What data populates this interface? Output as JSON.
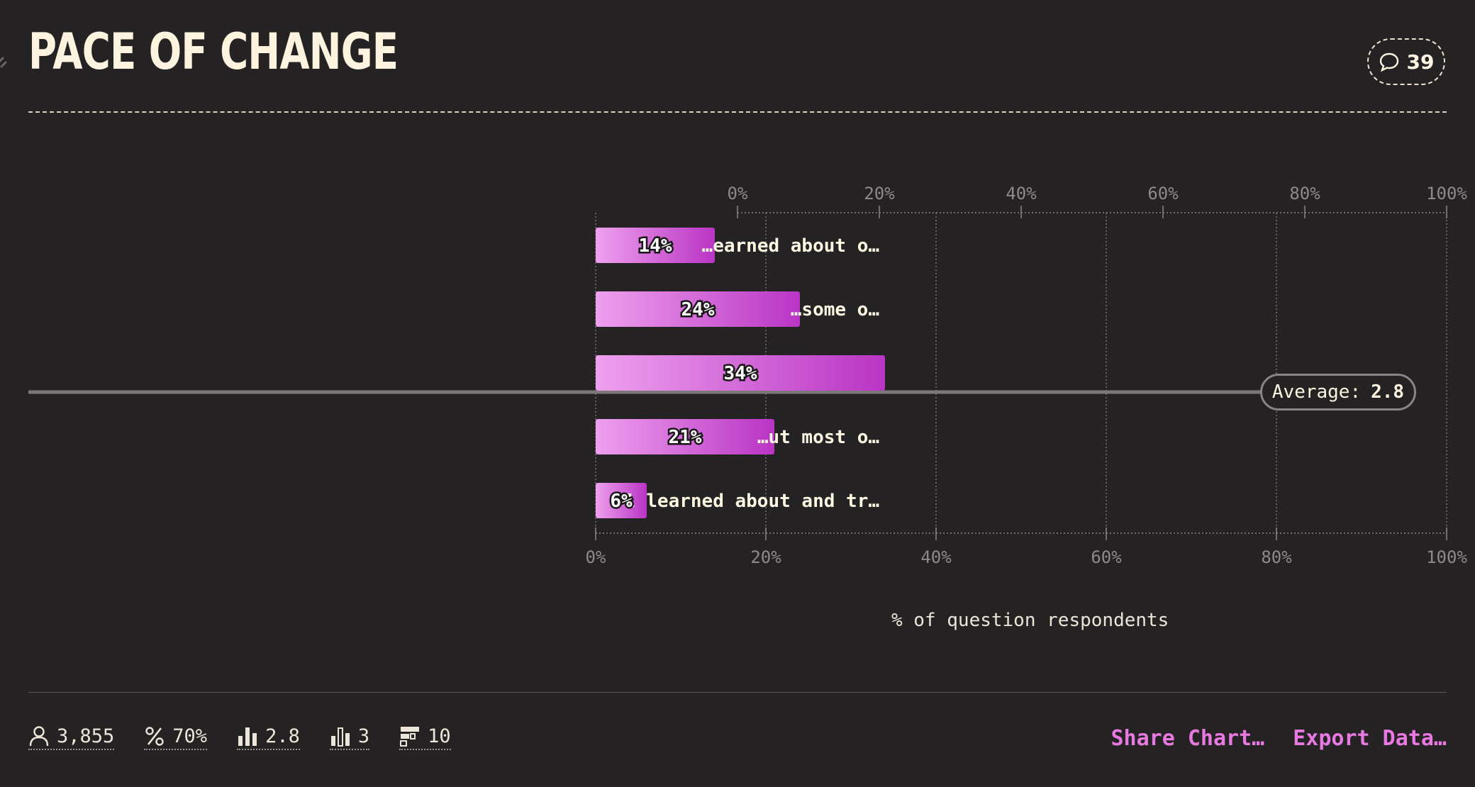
{
  "header": {
    "title": "PACE OF CHANGE",
    "comment_count": "39"
  },
  "chart_data": {
    "type": "bar",
    "orientation": "horizontal",
    "categories": [
      "…earned about o…",
      "…some o…",
      "",
      "…ut most o…",
      "1 learned about and tr…"
    ],
    "values": [
      14,
      24,
      34,
      21,
      6
    ],
    "value_labels": [
      "14%",
      "24%",
      "34%",
      "21%",
      "6%"
    ],
    "xlim": [
      0,
      100
    ],
    "ticks": [
      "0%",
      "20%",
      "40%",
      "60%",
      "80%",
      "100%"
    ],
    "xlabel": "% of question respondents",
    "average": {
      "label": "Average:",
      "value": "2.8"
    },
    "grid": true,
    "bar_color_start": "#eea0ee",
    "bar_color_end": "#b935c4"
  },
  "footer": {
    "stats": [
      {
        "icon": "person-icon",
        "value": "3,855"
      },
      {
        "icon": "percent-icon",
        "value": "70%"
      },
      {
        "icon": "average-bars-icon",
        "value": "2.8"
      },
      {
        "icon": "median-bars-icon",
        "value": "3"
      },
      {
        "icon": "table-icon",
        "value": "10"
      }
    ],
    "share_label": "Share Chart…",
    "export_label": "Export Data…"
  }
}
